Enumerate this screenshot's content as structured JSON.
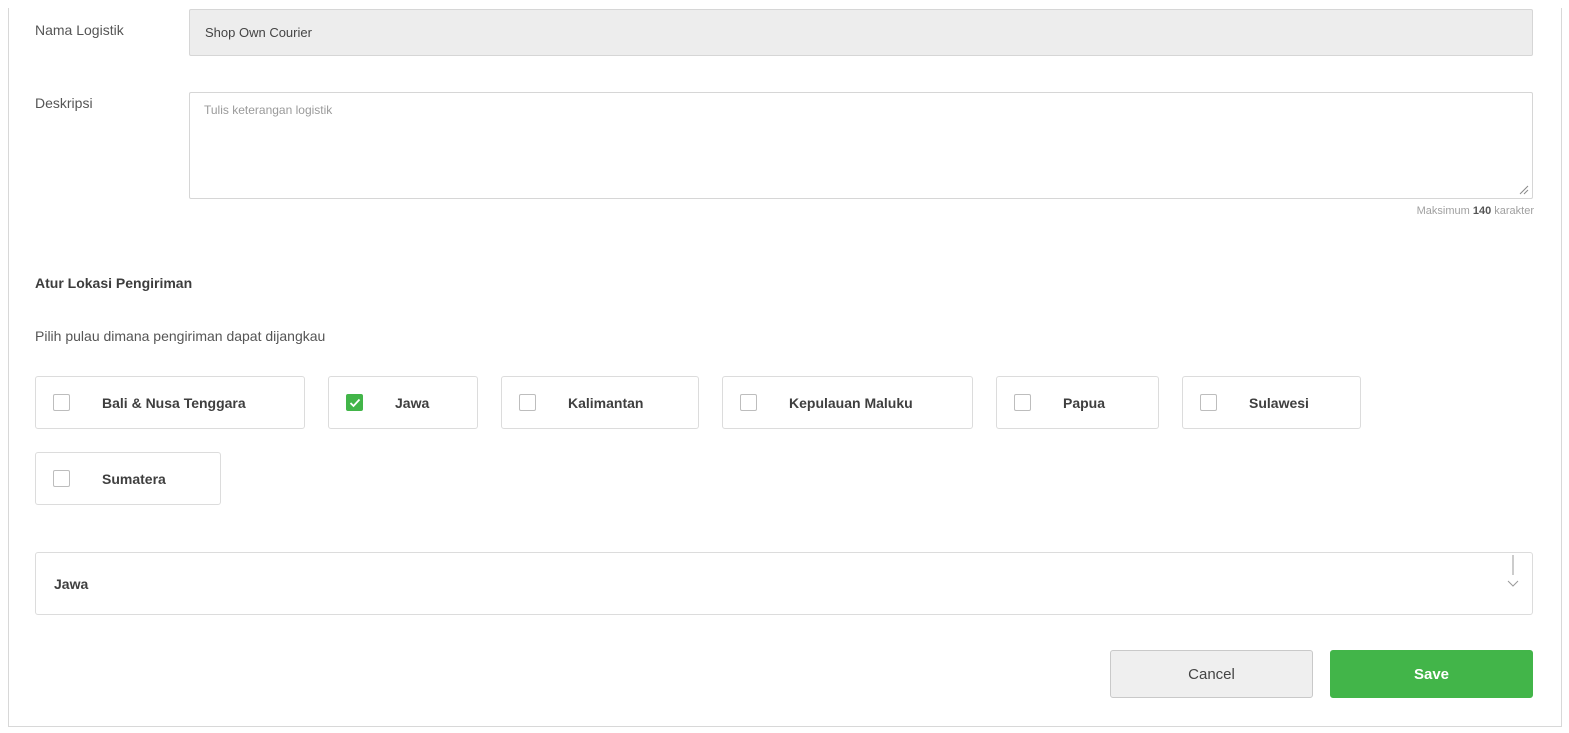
{
  "form": {
    "name_label": "Nama Logistik",
    "name_value": "Shop Own Courier",
    "desc_label": "Deskripsi",
    "desc_placeholder": "Tulis keterangan logistik",
    "desc_value": "",
    "helper_prefix": "Maksimum ",
    "helper_count": "140",
    "helper_suffix": " karakter"
  },
  "shipping": {
    "title": "Atur Lokasi Pengiriman",
    "subtitle": "Pilih pulau dimana pengiriman dapat dijangkau",
    "islands": [
      {
        "label": "Bali & Nusa Tenggara",
        "checked": false
      },
      {
        "label": "Jawa",
        "checked": true
      },
      {
        "label": "Kalimantan",
        "checked": false
      },
      {
        "label": "Kepulauan Maluku",
        "checked": false
      },
      {
        "label": "Papua",
        "checked": false
      },
      {
        "label": "Sulawesi",
        "checked": false
      },
      {
        "label": "Sumatera",
        "checked": false
      }
    ],
    "selected_panel": {
      "title": "Jawa",
      "icon": "chevron-down-icon"
    }
  },
  "actions": {
    "cancel_label": "Cancel",
    "save_label": "Save"
  },
  "colors": {
    "accent": "#42b549",
    "border": "#dcdcdc",
    "readonly_bg": "#ededed"
  }
}
